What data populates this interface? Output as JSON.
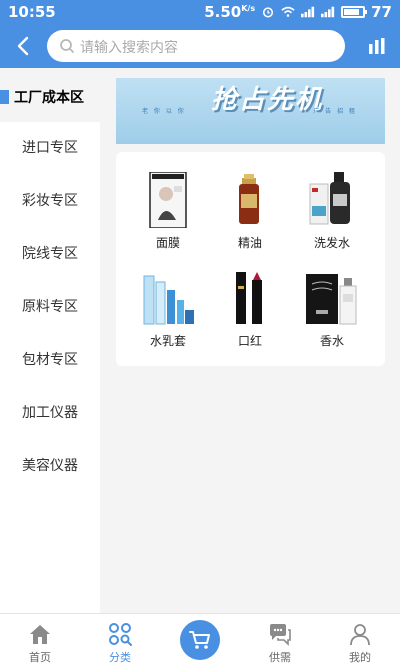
{
  "status_bar": {
    "time": "10:55",
    "speed": "5.50",
    "speed_unit": "K/s",
    "battery": "77"
  },
  "search": {
    "placeholder": "请输入搜索内容"
  },
  "sidebar": {
    "active_label": "工厂成本区",
    "items": [
      {
        "label": "进口专区"
      },
      {
        "label": "彩妆专区"
      },
      {
        "label": "院线专区"
      },
      {
        "label": "原料专区"
      },
      {
        "label": "包材专区"
      },
      {
        "label": "加工仪器"
      },
      {
        "label": "美容仪器"
      }
    ]
  },
  "banner": {
    "left_caption": "老 你 以 你",
    "right_caption": "广 告 招 租",
    "headline": "抢占先机"
  },
  "categories": [
    {
      "label": "面膜",
      "icon": "face-mask-product-icon"
    },
    {
      "label": "精油",
      "icon": "essential-oil-bottle-icon"
    },
    {
      "label": "洗发水",
      "icon": "shampoo-bottle-icon"
    },
    {
      "label": "水乳套",
      "icon": "lotion-set-icon"
    },
    {
      "label": "口红",
      "icon": "lipstick-icon"
    },
    {
      "label": "香水",
      "icon": "perfume-icon"
    }
  ],
  "bottom_nav": {
    "items": [
      {
        "label": "首页",
        "icon": "home-icon"
      },
      {
        "label": "分类",
        "icon": "category-icon"
      },
      {
        "label": "",
        "icon": "cart-icon"
      },
      {
        "label": "供需",
        "icon": "chat-icon"
      },
      {
        "label": "我的",
        "icon": "user-icon"
      }
    ],
    "active_index": 1
  },
  "colors": {
    "brand": "#4a90e2",
    "background": "#f4f4f4"
  }
}
